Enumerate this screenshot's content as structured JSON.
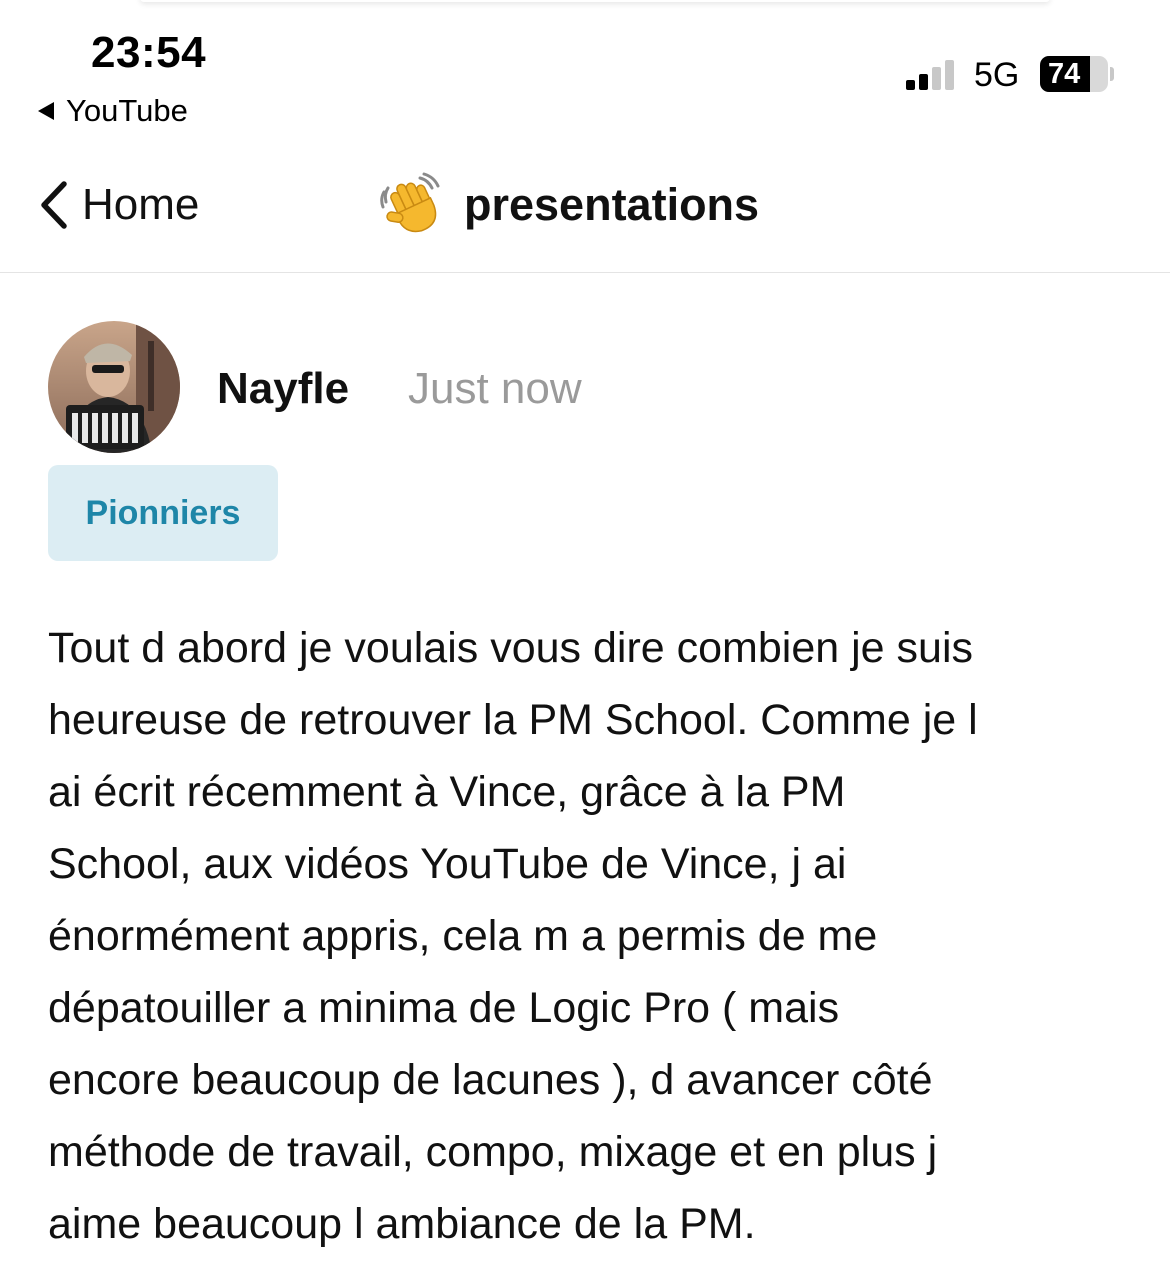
{
  "status_bar": {
    "time": "23:54",
    "back_app": "YouTube",
    "network": "5G",
    "battery_percent": "74",
    "battery_level": 0.74,
    "signal_bars_active": 2,
    "signal_bars_total": 4
  },
  "header": {
    "back_label": "Home",
    "title_emoji": "waving-hand-icon",
    "title": "presentations"
  },
  "post": {
    "author": "Nayfle",
    "timestamp": "Just now",
    "badge": "Pionniers",
    "body_lines": [
      "Tout d abord je voulais vous dire combien je suis",
      "heureuse de retrouver la PM School. Comme je l",
      "ai écrit récemment à Vince, grâce à la PM",
      "School, aux vidéos YouTube de Vince, j ai",
      "énormément appris, cela m a permis de me",
      "dépatouiller a minima de Logic Pro ( mais",
      "encore beaucoup de lacunes ), d avancer côté",
      "méthode de travail, compo, mixage et en plus j",
      "aime beaucoup l ambiance de la PM."
    ]
  },
  "colors": {
    "badge_bg": "#dcedf3",
    "badge_text": "#1e86a8",
    "muted_text": "#9a9a9a",
    "divider": "#e4e4e4"
  }
}
